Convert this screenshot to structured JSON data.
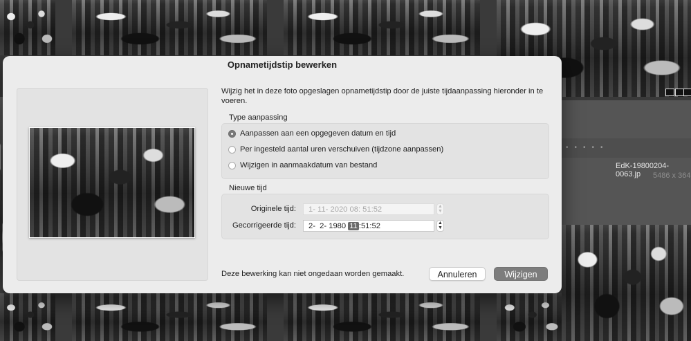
{
  "background": {
    "filename": "EdK-19800204-0063.jp",
    "dimensions": "5486 x 364"
  },
  "dialog": {
    "title": "Opnametijdstip bewerken",
    "description": "Wijzig het in deze foto opgeslagen opnametijdstip door de juiste tijdaanpassing hieronder in te voeren.",
    "type_group": {
      "label": "Type aanpassing",
      "options": [
        {
          "label": "Aanpassen aan een opgegeven datum en tijd",
          "selected": true
        },
        {
          "label": "Per ingesteld aantal uren verschuiven (tijdzone aanpassen)",
          "selected": false
        },
        {
          "label": "Wijzigen in aanmaakdatum van bestand",
          "selected": false
        }
      ]
    },
    "time_group": {
      "label": "Nieuwe tijd",
      "original_label": "Originele tijd:",
      "original_value": "1- 11- 2020 08: 51:52",
      "corrected_label": "Gecorrigeerde tijd:",
      "corrected_before": "2-  2- 1980 ",
      "corrected_selected": "11",
      "corrected_after": ":51:52"
    },
    "footer_note": "Deze bewerking kan niet ongedaan worden gemaakt.",
    "cancel_label": "Annuleren",
    "confirm_label": "Wijzigen"
  },
  "icons": {
    "stepper_up": "▲",
    "stepper_down": "▼"
  }
}
